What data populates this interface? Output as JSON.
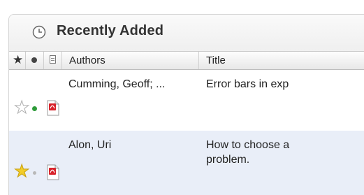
{
  "panel": {
    "title": "Recently Added",
    "icon": "clock-icon"
  },
  "columns": {
    "star_icon": "star-icon",
    "unread_icon": "dot-icon",
    "attachment_icon": "document-icon",
    "authors": "Authors",
    "title": "Title"
  },
  "rows": [
    {
      "starred": false,
      "unread": true,
      "attachment": "pdf-icon",
      "authors": "Cumming, Geoff; ...",
      "title_line1": "Error bars in exp",
      "title_line2": ""
    },
    {
      "starred": true,
      "unread": false,
      "attachment": "pdf-icon",
      "authors": "Alon, Uri",
      "title_line1": "How to choose a",
      "title_line2": "problem."
    }
  ],
  "colors": {
    "star_filled": "#f2cd2a",
    "unread_dot": "#2e9b3a",
    "selected_row": "#e9eef8"
  }
}
